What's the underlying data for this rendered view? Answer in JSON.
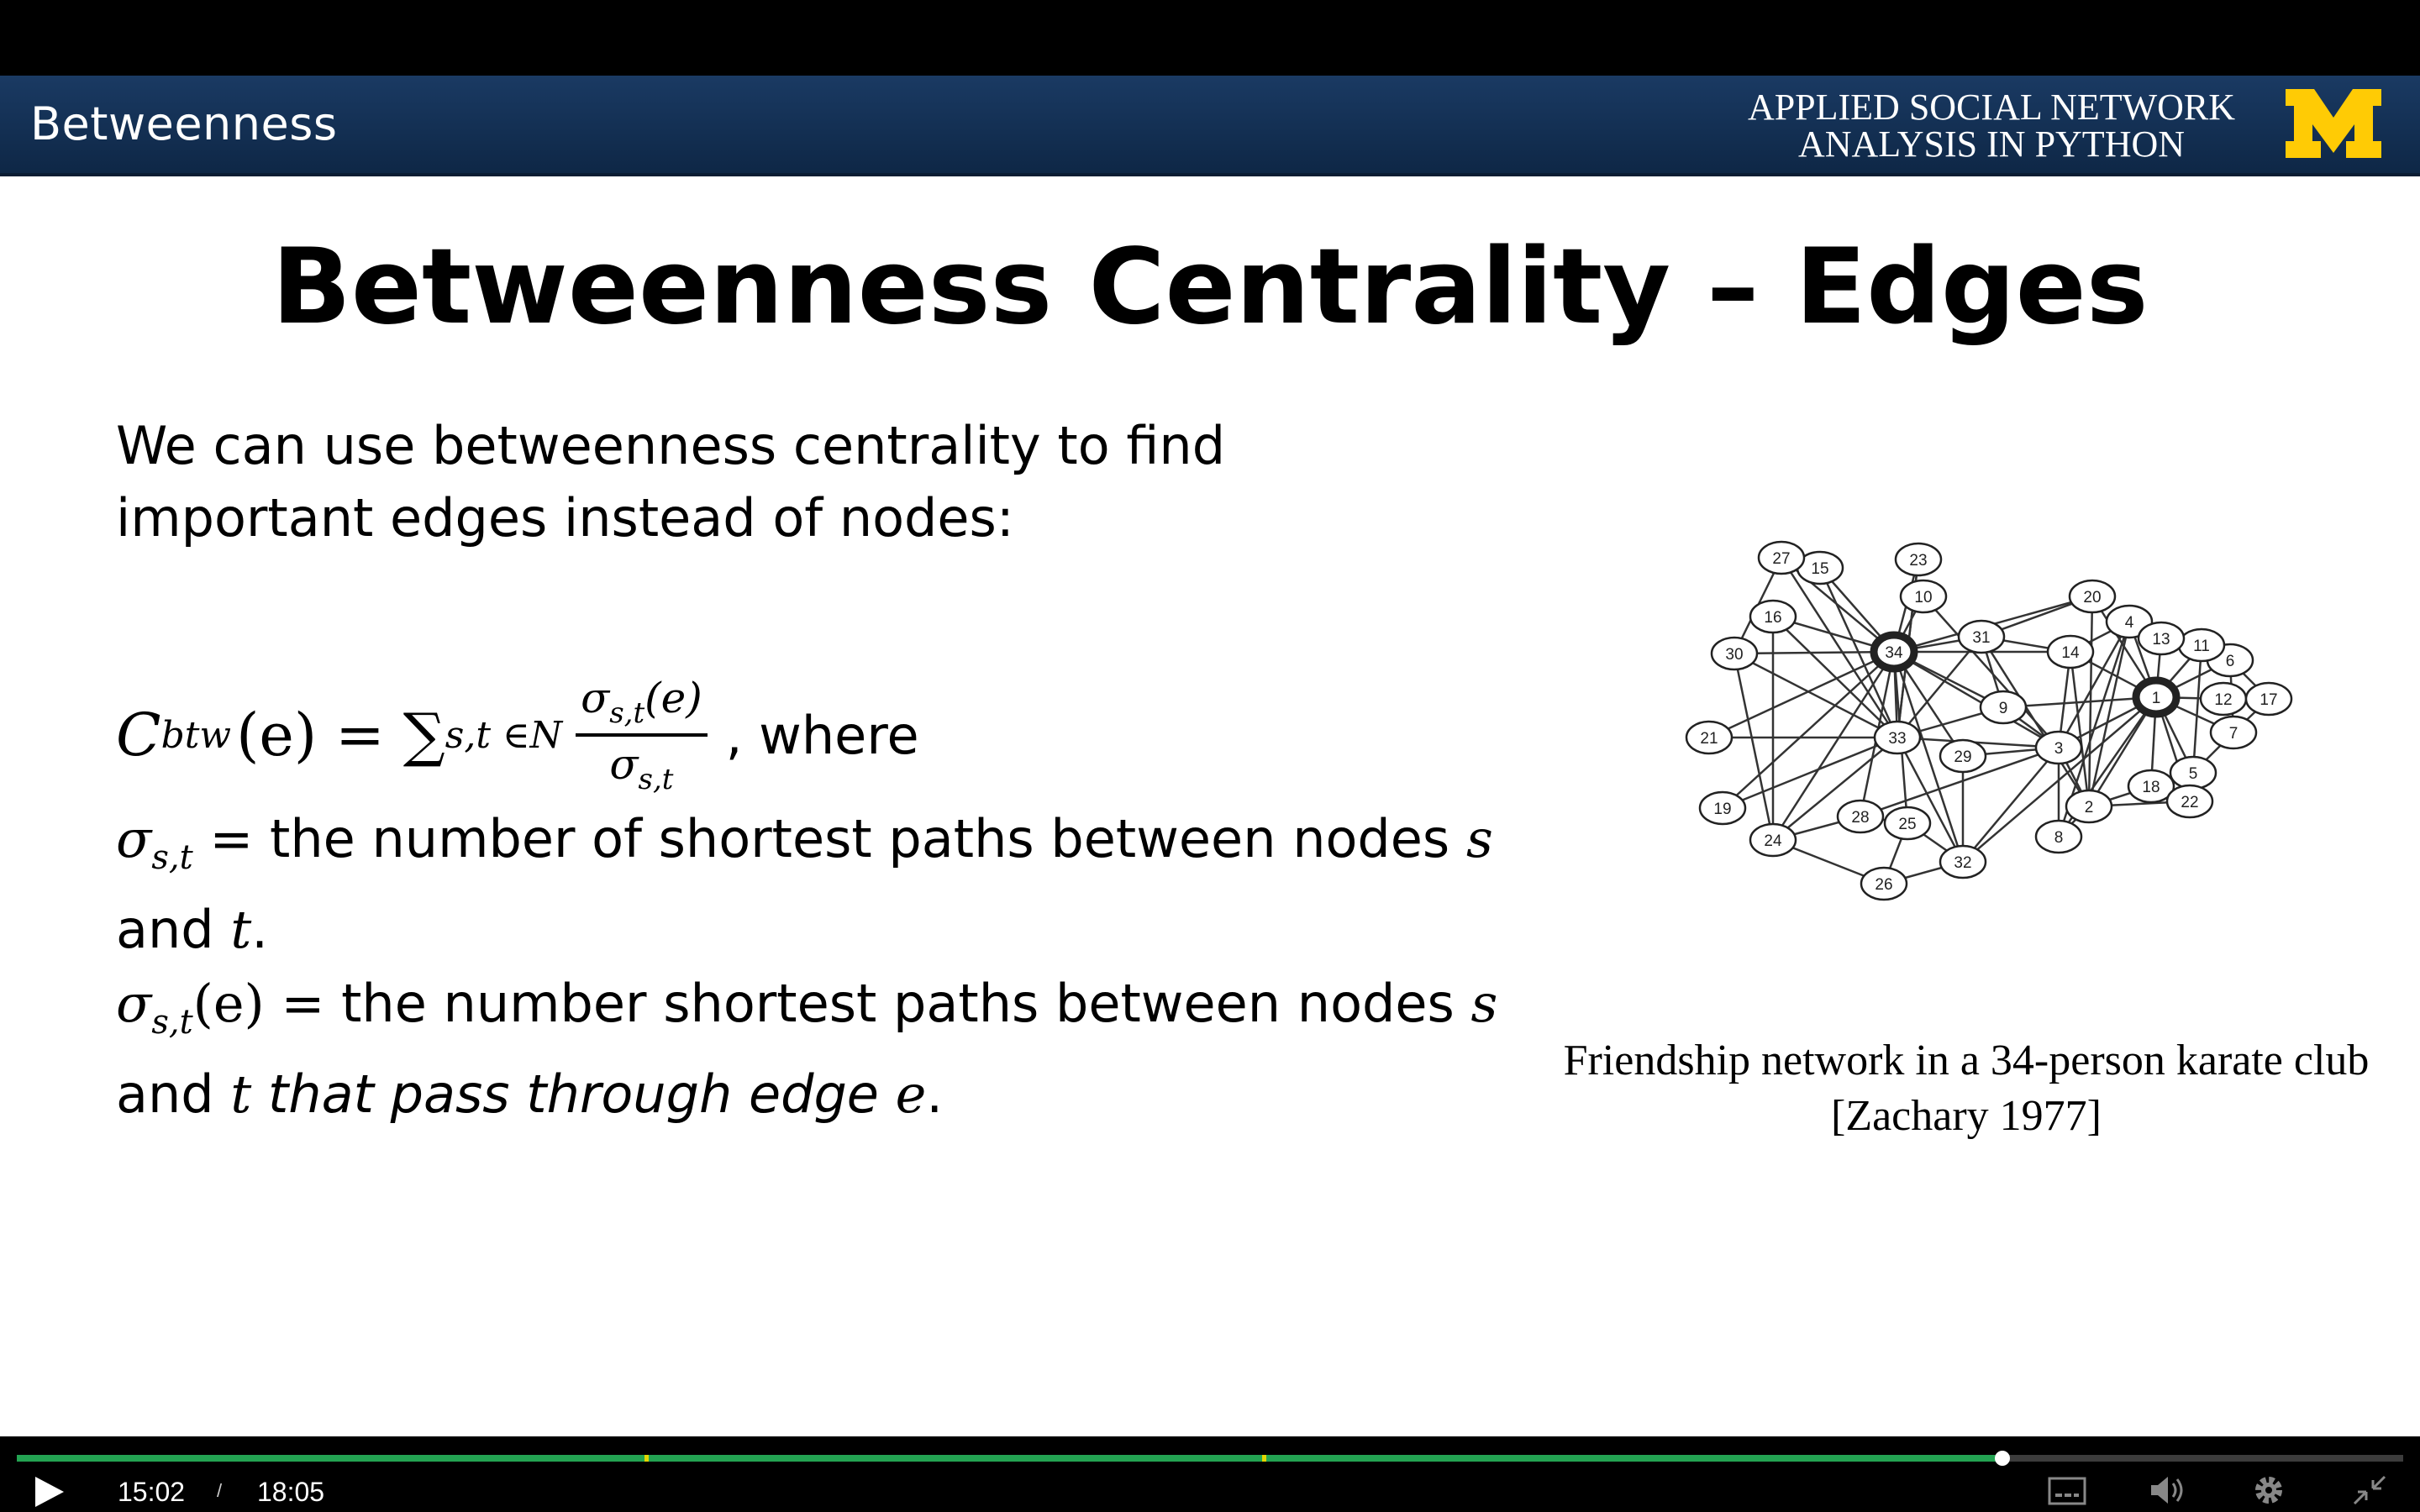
{
  "banner": {
    "title": "Betweenness",
    "course": "APPLIED SOCIAL NETWORK ANALYSIS IN PYTHON",
    "logo": "M"
  },
  "slide": {
    "title": "Betweenness Centrality – Edges",
    "intro": "We can use betweenness centrality to find important edges instead of nodes:",
    "formula": {
      "lhs_symbol": "C",
      "lhs_sub": "btw",
      "lhs_arg": "(e)",
      "equals": "=",
      "sum": "∑",
      "sum_sub": "s,t ∈N",
      "numerator": "σ",
      "numerator_sub": "s,t",
      "numerator_arg": "(e)",
      "denominator": "σ",
      "denominator_sub": "s,t",
      "suffix": ", where"
    },
    "def1": {
      "symbol": "σ",
      "sub": "s,t",
      "text_a": " = the number of shortest paths between nodes ",
      "s": "s",
      "text_b": " and ",
      "t": "t",
      "end": "."
    },
    "def2": {
      "symbol": "σ",
      "sub": "s,t",
      "arg": "(e)",
      "text_a": " = the number shortest paths between nodes ",
      "s": "s",
      "text_b": " and ",
      "t": "t",
      "text_c": " that pass through edge ",
      "e": "e",
      "end": "."
    },
    "caption_line1": "Friendship network in a 34-person karate club",
    "caption_line2": "[Zachary 1977]"
  },
  "network": {
    "hubs": [
      "1",
      "34"
    ],
    "nodes": [
      "1",
      "2",
      "3",
      "4",
      "5",
      "6",
      "7",
      "8",
      "9",
      "10",
      "11",
      "12",
      "13",
      "14",
      "15",
      "16",
      "17",
      "18",
      "19",
      "20",
      "21",
      "22",
      "23",
      "24",
      "25",
      "26",
      "27",
      "28",
      "29",
      "30",
      "31",
      "32",
      "33",
      "34"
    ]
  },
  "player": {
    "current_time": "15:02",
    "separator": "/",
    "duration": "18:05",
    "progress": 0.832,
    "chapter_marks": [
      0.263,
      0.522
    ],
    "colors": {
      "progress": "#23a352",
      "chapter": "#e3d600"
    },
    "icons": [
      "play-icon",
      "captions-icon",
      "volume-icon",
      "settings-icon",
      "exit-fullscreen-icon"
    ]
  }
}
